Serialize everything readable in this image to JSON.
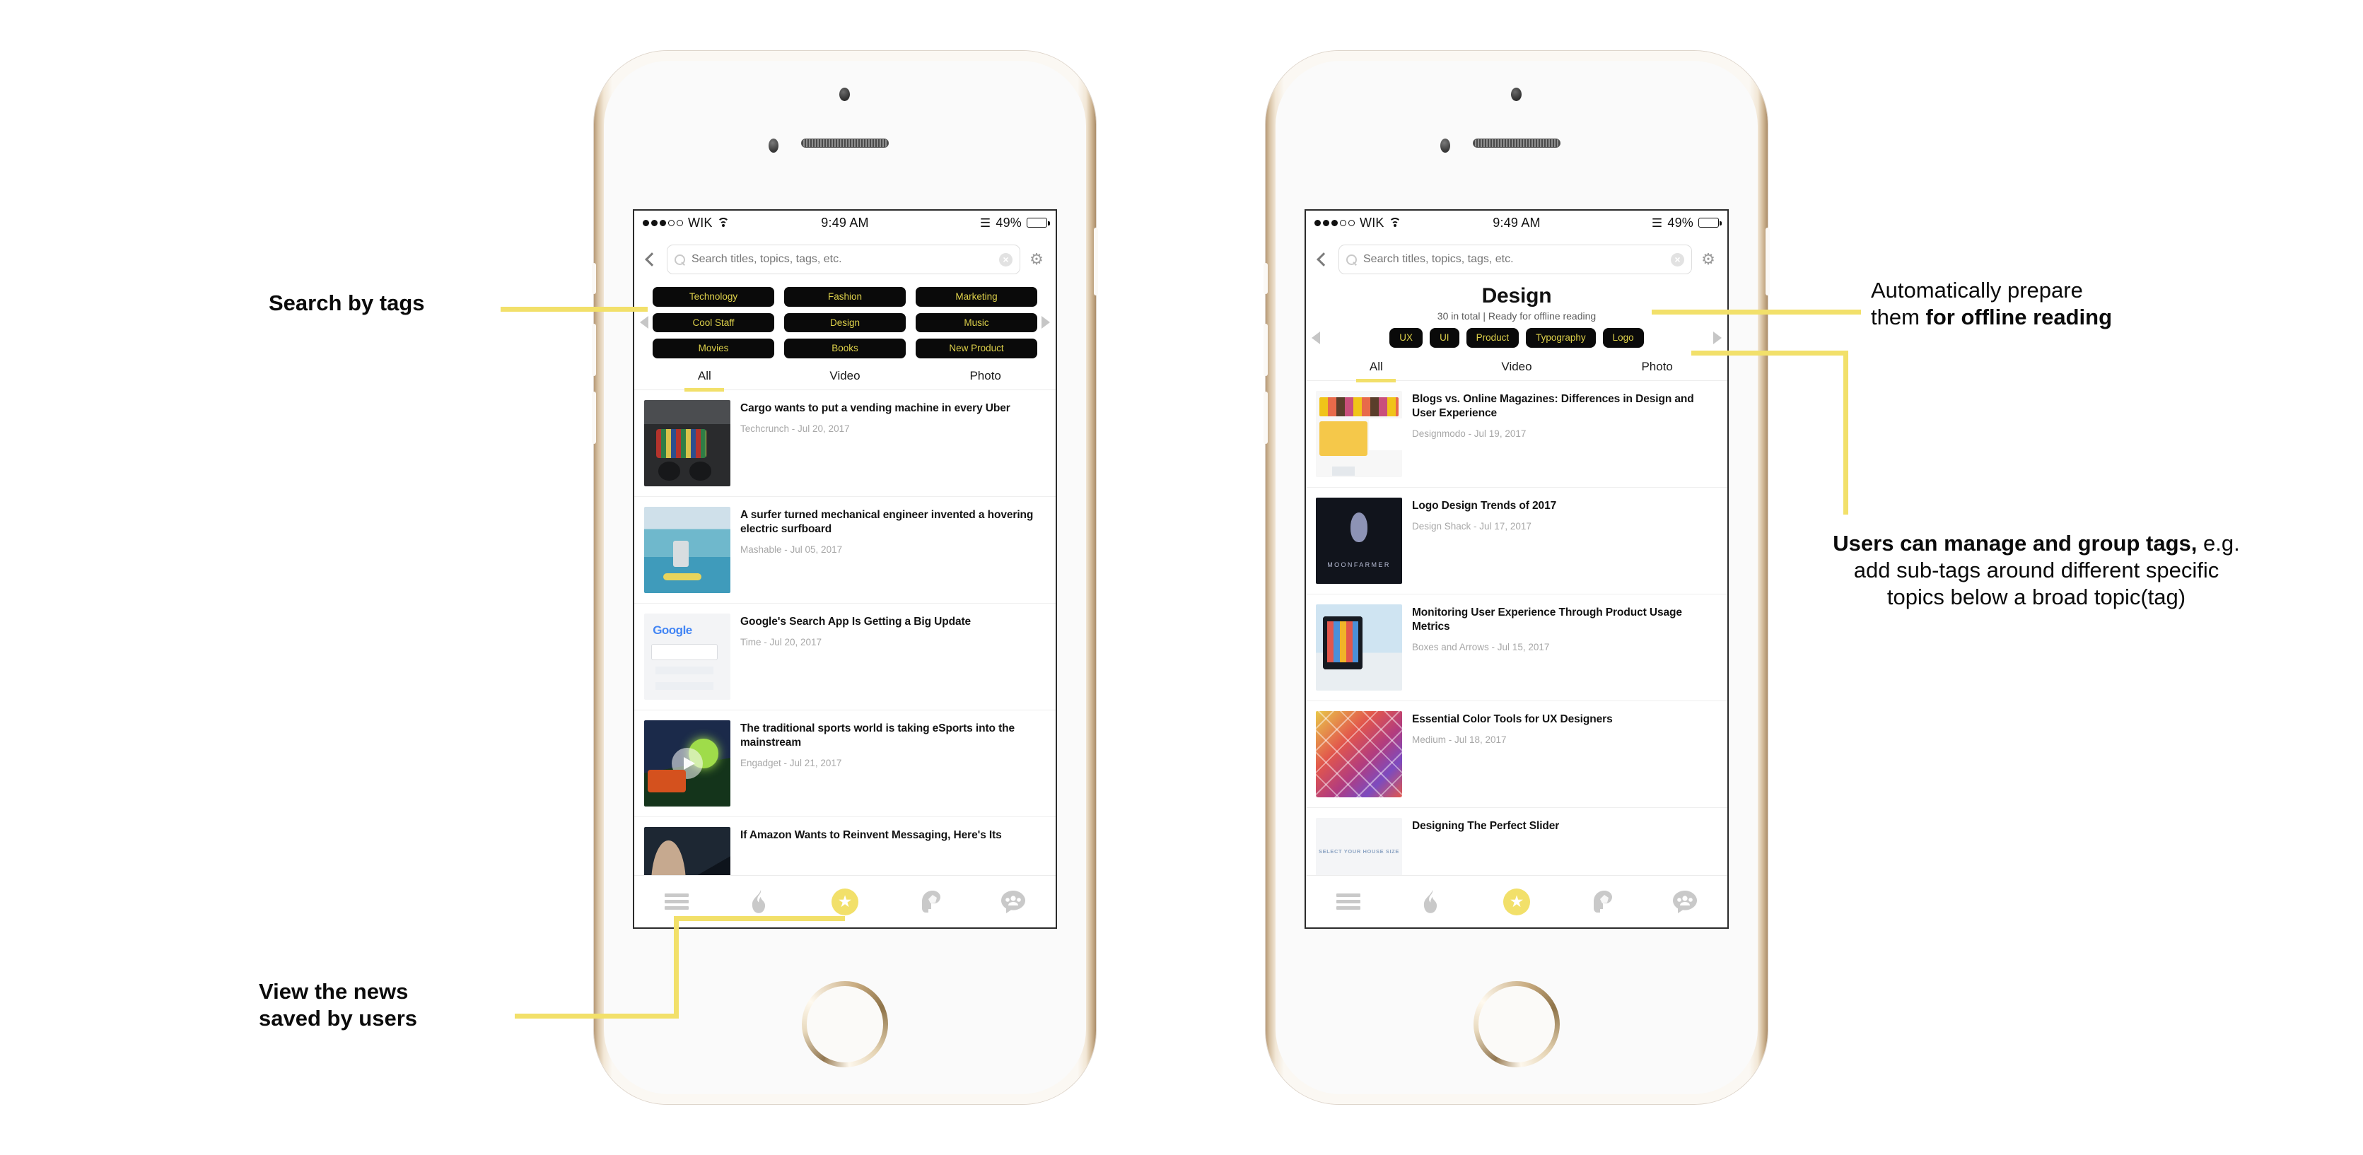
{
  "colors": {
    "accent_yellow": "#f2e06a",
    "pill_bg": "#0a0a0a",
    "pill_text": "#ddd04a",
    "meta_gray": "#a7a7a7"
  },
  "status_bar": {
    "carrier": "WIK",
    "time": "9:49 AM",
    "battery_percent": "49%",
    "signal_filled": 3,
    "signal_total": 5,
    "wifi_icon": "wifi-icon",
    "bluetooth_icon": "bluetooth-icon",
    "battery_icon": "battery-icon"
  },
  "search": {
    "placeholder": "Search titles, topics, tags, etc.",
    "value": "",
    "search_icon": "search-icon",
    "clear_icon": "clear-circle-icon",
    "settings_icon": "gear-icon",
    "back_icon": "back-chevron-icon"
  },
  "left_phone": {
    "tags": [
      "Technology",
      "Fashion",
      "Marketing",
      "Cool Staff",
      "Design",
      "Music",
      "Movies",
      "Books",
      "New Product"
    ],
    "prev_icon": "arrow-left-icon",
    "next_icon": "arrow-right-icon",
    "tabs": [
      {
        "label": "All",
        "active": true
      },
      {
        "label": "Video",
        "active": false
      },
      {
        "label": "Photo",
        "active": false
      }
    ],
    "articles": [
      {
        "title": "Cargo wants to put a vending machine in every Uber",
        "source": "Techcrunch",
        "date": "Jul 20, 2017",
        "meta": "Techcrunch - Jul 20, 2017",
        "thumb": "th-car",
        "video": false
      },
      {
        "title": "A surfer turned mechanical engineer invented a hovering electric surfboard",
        "source": "Mashable",
        "date": "Jul 05, 2017",
        "meta": "Mashable - Jul 05, 2017",
        "thumb": "th-surf",
        "video": false
      },
      {
        "title": "Google's Search App Is Getting a Big Update",
        "source": "Time",
        "date": "Jul 20, 2017",
        "meta": "Time - Jul 20, 2017",
        "thumb": "th-google",
        "video": false
      },
      {
        "title": "The traditional sports world is taking eSports into the mainstream",
        "source": "Engadget",
        "date": "Jul 21, 2017",
        "meta": "Engadget - Jul 21, 2017",
        "thumb": "th-esports",
        "video": true
      },
      {
        "title": "If Amazon Wants to Reinvent Messaging, Here's Its",
        "source": "",
        "date": "",
        "meta": "",
        "thumb": "th-amazon",
        "video": false
      }
    ]
  },
  "right_phone": {
    "title": "Design",
    "subtitle": "30 in total | Ready for offline reading",
    "subtags": [
      "UX",
      "UI",
      "Product",
      "Typography",
      "Logo"
    ],
    "prev_icon": "arrow-left-icon",
    "next_icon": "arrow-right-icon",
    "tabs": [
      {
        "label": "All",
        "active": true
      },
      {
        "label": "Video",
        "active": false
      },
      {
        "label": "Photo",
        "active": false
      }
    ],
    "articles": [
      {
        "title": "Blogs vs. Online Magazines: Differences in Design and User Experience",
        "source": "Designmodo",
        "date": "Jul 19, 2017",
        "meta": "Designmodo - Jul 19, 2017",
        "thumb": "th-blogs",
        "video": false
      },
      {
        "title": "Logo Design Trends of 2017",
        "source": "Design Shack",
        "date": "Jul 17, 2017",
        "meta": "Design Shack - Jul 17, 2017",
        "thumb": "th-moon",
        "video": false
      },
      {
        "title": "Monitoring User Experience Through Product Usage Metrics",
        "source": "Boxes and Arrows",
        "date": "Jul 15, 2017",
        "meta": "Boxes and Arrows - Jul 15, 2017",
        "thumb": "th-metrics",
        "video": false
      },
      {
        "title": "Essential Color Tools for UX Designers",
        "source": "Medium",
        "date": "Jul 18, 2017",
        "meta": "Medium - Jul 18, 2017",
        "thumb": "th-color",
        "video": false
      },
      {
        "title": "Designing The Perfect Slider",
        "source": "",
        "date": "",
        "meta": "",
        "thumb": "th-slider",
        "video": false
      }
    ]
  },
  "bottom_nav": {
    "items": [
      {
        "icon": "hamburger-menu-icon",
        "active": false
      },
      {
        "icon": "flame-trending-icon",
        "active": false
      },
      {
        "icon": "star-saved-icon",
        "active": true
      },
      {
        "icon": "brain-head-icon",
        "active": false
      },
      {
        "icon": "people-chat-icon",
        "active": false
      }
    ]
  },
  "annotations": {
    "search_by_tags": "Search by tags",
    "view_saved_line1": "View the news",
    "view_saved_line2": "saved by users",
    "offline_line1": "Automatically prepare",
    "offline_line2_plain": "them ",
    "offline_line2_bold": "for offline reading",
    "manage_bold": "Users can manage and group tags,",
    "manage_rest": " e.g. add sub-tags around different specific  topics below a broad topic(tag)"
  }
}
